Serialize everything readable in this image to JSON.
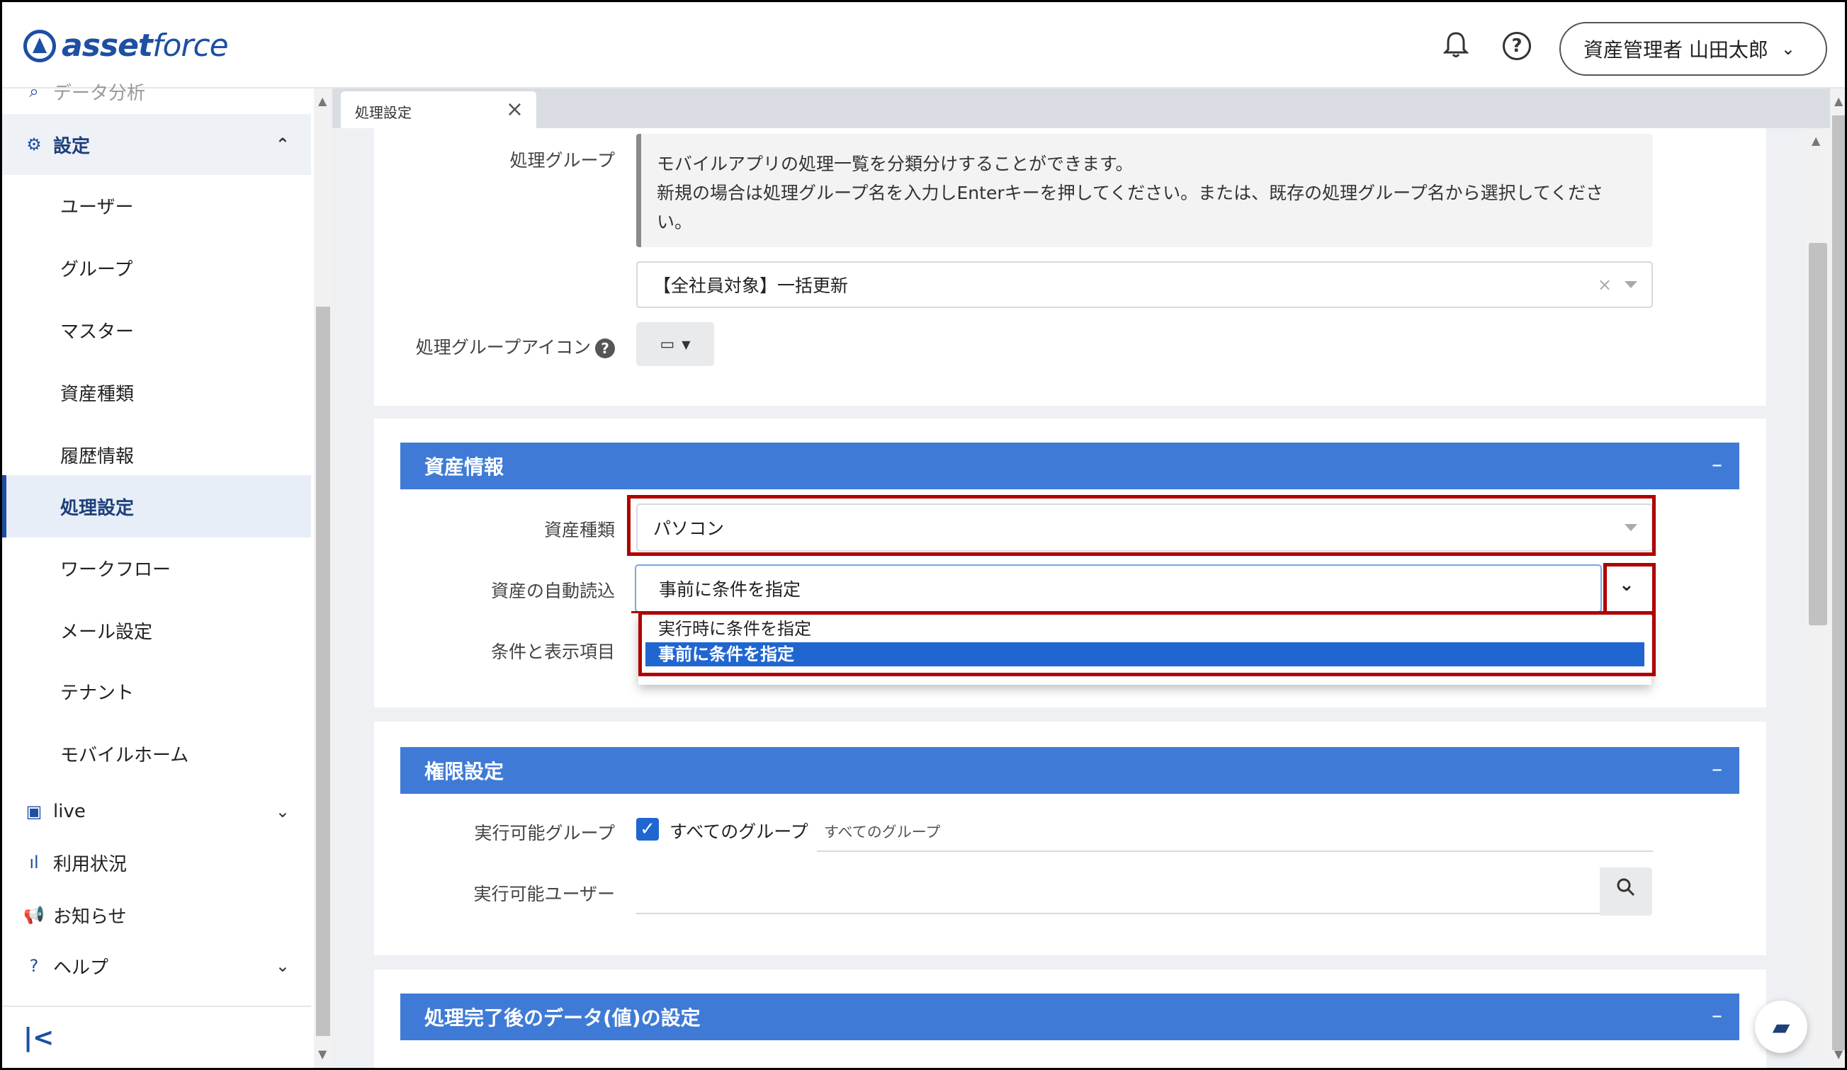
{
  "header": {
    "logo_bold": "asset",
    "logo_light": "force",
    "user_label": "資産管理者 山田太郎"
  },
  "sidebar": {
    "partial_top": "データ分析",
    "settings_label": "設定",
    "sub_items": [
      "ユーザー",
      "グループ",
      "マスター",
      "資産種類",
      "履歴情報",
      "処理設定",
      "ワークフロー",
      "メール設定",
      "テナント",
      "モバイルホーム"
    ],
    "active_item": "処理設定",
    "live_label": "live",
    "usage_label": "利用状況",
    "notice_label": "お知らせ",
    "help_label": "ヘルプ"
  },
  "tab": {
    "label": "処理設定"
  },
  "group": {
    "label": "処理グループ",
    "info_line1": "モバイルアプリの処理一覧を分類分けすることができます。",
    "info_line2": "新規の場合は処理グループ名を入力しEnterキーを押してください。または、既存の処理グループ名から選択してくださ",
    "info_line3": "い。",
    "value": "【全社員対象】一括更新",
    "icon_label": "処理グループアイコン"
  },
  "asset_info": {
    "title": "資産情報",
    "asset_type_label": "資産種類",
    "asset_type_value": "パソコン",
    "auto_read_label": "資産の自動読込",
    "auto_read_value": "事前に条件を指定",
    "conditions_label": "条件と表示項目",
    "options": [
      "実行時に条件を指定",
      "事前に条件を指定"
    ]
  },
  "permissions": {
    "title": "権限設定",
    "group_label": "実行可能グループ",
    "all_groups_check": "すべてのグループ",
    "all_groups_tag": "すべてのグループ",
    "user_label": "実行可能ユーザー"
  },
  "after": {
    "title": "処理完了後のデータ(値)の設定"
  },
  "colors": {
    "section_blue": "#3f7bd6",
    "highlight_red": "#b00000",
    "selected_option": "#1f66d1"
  }
}
